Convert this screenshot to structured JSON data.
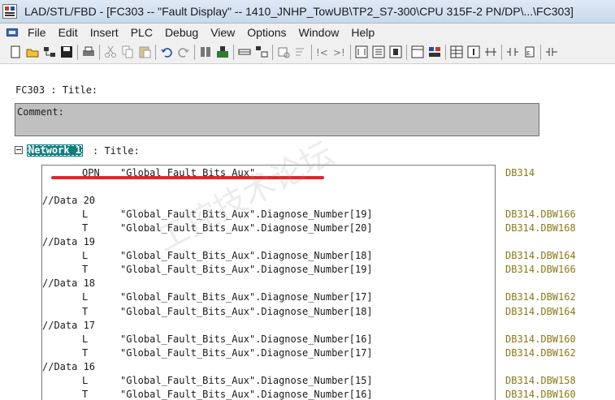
{
  "window": {
    "title": "LAD/STL/FBD  - [FC303 -- \"Fault Display\" -- 1410_JNHP_TowUB\\TP2_S7-300\\CPU 315F-2 PN/DP\\...\\FC303]"
  },
  "menu": [
    "File",
    "Edit",
    "Insert",
    "PLC",
    "Debug",
    "View",
    "Options",
    "Window",
    "Help"
  ],
  "toolbar_icons": [
    "new-icon",
    "open-icon",
    "accessible-nodes-icon",
    "save-icon",
    "print-icon",
    "cut-icon",
    "copy-icon",
    "paste-icon",
    "undo-icon",
    "redo-icon",
    "download-icon",
    "monitor-icon",
    "overview-icon",
    "program-elements-icon",
    "address-icon",
    "comment-icon",
    "jump-back-icon",
    "jump-forward-icon",
    "lad-icon",
    "stl-icon",
    "fbd-icon",
    "view-detail-icon",
    "symbol-icon",
    "table-icon",
    "info-icon",
    "network-insert-icon",
    "contact-icon",
    "box-icon",
    "branch-icon"
  ],
  "editor": {
    "block_title": "FC303 : Title:",
    "comment_label": "Comment:",
    "network_label": "Network 1",
    "network_title": ": Title:",
    "lines": [
      {
        "kind": "instr",
        "op": "OPN",
        "operand": "\"Global_Fault_Bits_Aux\"",
        "address": "DB314"
      },
      {
        "kind": "blank"
      },
      {
        "kind": "comment",
        "text": "//Data 20"
      },
      {
        "kind": "instr",
        "op": "L",
        "operand": "\"Global_Fault_Bits_Aux\".Diagnose_Number[19]",
        "address": "DB314.DBW166"
      },
      {
        "kind": "instr",
        "op": "T",
        "operand": "\"Global_Fault_Bits_Aux\".Diagnose_Number[20]",
        "address": "DB314.DBW168"
      },
      {
        "kind": "comment",
        "text": "//Data 19"
      },
      {
        "kind": "instr",
        "op": "L",
        "operand": "\"Global_Fault_Bits_Aux\".Diagnose_Number[18]",
        "address": "DB314.DBW164"
      },
      {
        "kind": "instr",
        "op": "T",
        "operand": "\"Global_Fault_Bits_Aux\".Diagnose_Number[19]",
        "address": "DB314.DBW166"
      },
      {
        "kind": "comment",
        "text": "//Data 18"
      },
      {
        "kind": "instr",
        "op": "L",
        "operand": "\"Global_Fault_Bits_Aux\".Diagnose_Number[17]",
        "address": "DB314.DBW162"
      },
      {
        "kind": "instr",
        "op": "T",
        "operand": "\"Global_Fault_Bits_Aux\".Diagnose_Number[18]",
        "address": "DB314.DBW164"
      },
      {
        "kind": "comment",
        "text": "//Data 17"
      },
      {
        "kind": "instr",
        "op": "L",
        "operand": "\"Global_Fault_Bits_Aux\".Diagnose_Number[16]",
        "address": "DB314.DBW160"
      },
      {
        "kind": "instr",
        "op": "T",
        "operand": "\"Global_Fault_Bits_Aux\".Diagnose_Number[17]",
        "address": "DB314.DBW162"
      },
      {
        "kind": "comment",
        "text": "//Data 16"
      },
      {
        "kind": "instr",
        "op": "L",
        "operand": "\"Global_Fault_Bits_Aux\".Diagnose_Number[15]",
        "address": "DB314.DBW158"
      },
      {
        "kind": "instr",
        "op": "T",
        "operand": "\"Global_Fault_Bits_Aux\".Diagnose_Number[16]",
        "address": "DB314.DBW160"
      }
    ]
  },
  "watermark": "工控技术论坛",
  "colors": {
    "network_label_bg": "#0e7e7e",
    "address_text": "#8a7a16",
    "annotation_red": "#e3262b"
  }
}
